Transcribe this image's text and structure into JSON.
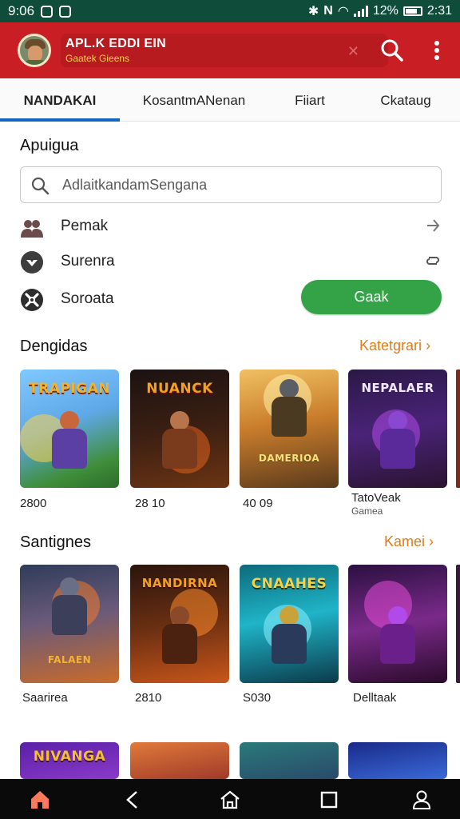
{
  "status_bar": {
    "time": "9:06",
    "network": "N",
    "battery": "12%",
    "clock": "2:31"
  },
  "header": {
    "title": "APL.K EDDI EIN",
    "subtitle": "Gaatek Gieens",
    "close_icon": "x-icon",
    "accent_color": "#c81e24"
  },
  "tabs": [
    {
      "label": "NANDAKAI",
      "active": true
    },
    {
      "label": "KosantmANenan",
      "active": false
    },
    {
      "label": "Fiiart",
      "active": false
    },
    {
      "label": "Ckataug",
      "active": false
    }
  ],
  "main": {
    "section_title": "Apuigua",
    "search_placeholder": "AdlaitkandamSengana",
    "rows": [
      {
        "label": "Pemak",
        "icon": "people-icon",
        "trailing": "chevron-right-icon"
      },
      {
        "label": "Surenra",
        "icon": "shield-icon",
        "trailing": "sync-icon"
      },
      {
        "label": "Soroata",
        "icon": "tools-icon",
        "trailing": ""
      }
    ],
    "action_button": "Gaak"
  },
  "sections": [
    {
      "title": "Dengidas",
      "link": "Katetgrari",
      "cards": [
        {
          "title": "TRAPIGAN",
          "caption": "2800",
          "sub": ""
        },
        {
          "title": "NUANCK",
          "caption": "28 10",
          "sub": ""
        },
        {
          "title": "DAMERIOA",
          "caption": "40 09",
          "sub": ""
        },
        {
          "title": "NEPALAER",
          "caption": "TatoVeak",
          "sub": "Gamea"
        }
      ]
    },
    {
      "title": "Santignes",
      "link": "Kamei",
      "cards": [
        {
          "title": "FALAEN",
          "caption": "Saarirea",
          "sub": ""
        },
        {
          "title": "NANDIRNA",
          "caption": "2810",
          "sub": ""
        },
        {
          "title": "CNAAHES",
          "caption": "S030",
          "sub": ""
        },
        {
          "title": "",
          "caption": "Delltaak",
          "sub": ""
        }
      ]
    },
    {
      "title": "",
      "link": "",
      "cards": [
        {
          "title": "NIVANGA",
          "caption": "",
          "sub": ""
        },
        {
          "title": "",
          "caption": "",
          "sub": ""
        },
        {
          "title": "",
          "caption": "",
          "sub": ""
        },
        {
          "title": "",
          "caption": "",
          "sub": ""
        }
      ]
    }
  ],
  "navbar": {
    "items": [
      "home-icon",
      "back-icon",
      "house-icon",
      "recents-icon",
      "profile-icon"
    ],
    "active_color": "#ff7a5a"
  }
}
